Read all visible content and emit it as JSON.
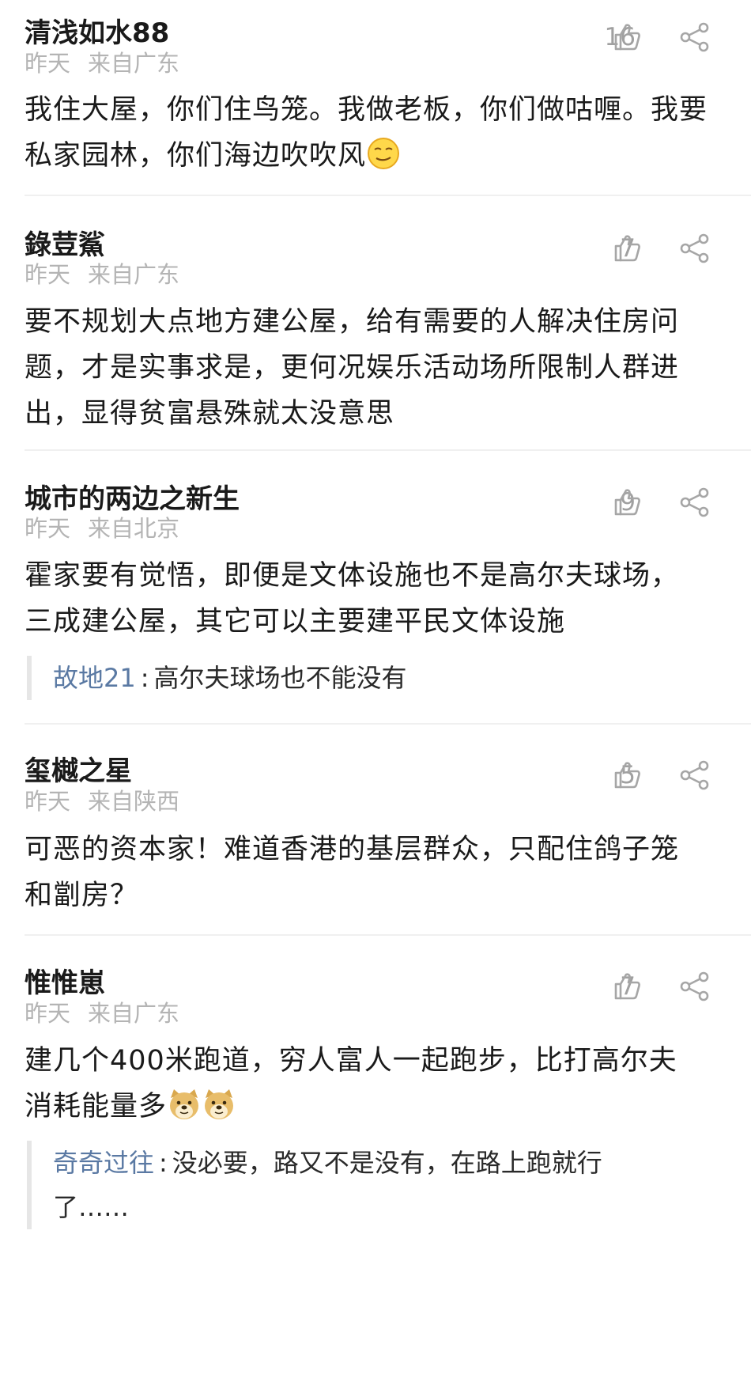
{
  "comments": [
    {
      "user": "清浅如水88",
      "time": "昨天",
      "location": "来自广东",
      "likes": "16",
      "text": "我住大屋，你们住鸟笼。我做老板，你们做咕喱。我要私家园林，你们海边吹吹风"
    },
    {
      "user": "錄荳鯊",
      "time": "昨天",
      "location": "来自广东",
      "likes": "7",
      "text_lines": [
        "要不规划大点地方建公屋，给有需要的人解决住房问",
        "题，才是实事求是，更何况娱乐活动场所限制人群进",
        "出，显得贫富悬殊就太没意思"
      ]
    },
    {
      "user": "城市的两边之新生",
      "time": "昨天",
      "location": "来自北京",
      "likes": "9",
      "text_lines": [
        "霍家要有觉悟，即便是文体设施也不是高尔夫球场，",
        "三成建公屋，其它可以主要建平民文体设施"
      ],
      "reply": {
        "user": "故地21",
        "sep": ":",
        "text": "高尔夫球场也不能没有"
      }
    },
    {
      "user": "玺樾之星",
      "time": "昨天",
      "location": "来自陕西",
      "likes": "5",
      "text_lines": [
        "可恶的资本家！难道香港的基层群众，只配住鸽子笼",
        "和劏房？"
      ]
    },
    {
      "user": "惟惟崽",
      "time": "昨天",
      "location": "来自广东",
      "likes": "7",
      "text_lines": [
        "建几个400米跑道，穷人富人一起跑步，比打高尔夫",
        "消耗能量多"
      ],
      "reply": {
        "user": "奇奇过往",
        "sep": ":",
        "text_lines": [
          "没必要，路又不是没有，在路上跑就行",
          "了……"
        ]
      }
    }
  ],
  "icons": {
    "like": "thumbs-up-icon",
    "share": "share-icon",
    "emoji_smile": "smirk-emoji",
    "emoji_doge": "doge-emoji"
  },
  "colors": {
    "text": "#1a1a1a",
    "meta": "#b4b4b4",
    "reply_user": "#5a79a3",
    "icon": "#a6a6a6"
  }
}
